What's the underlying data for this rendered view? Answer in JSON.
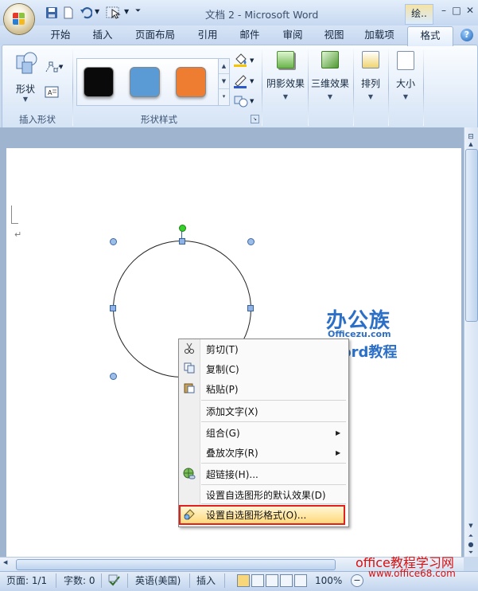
{
  "window": {
    "title": "文档 2 - Microsoft Word",
    "context_tool": "绘..",
    "controls": [
      "–",
      "□",
      "✕"
    ]
  },
  "tabs": [
    "开始",
    "插入",
    "页面布局",
    "引用",
    "邮件",
    "审阅",
    "视图",
    "加载项",
    "格式"
  ],
  "active_tab": "格式",
  "ribbon": {
    "groups": [
      {
        "label": "插入形状",
        "buttons": [
          "形状"
        ]
      },
      {
        "label": "形状样式",
        "swatches": [
          "#0a0a0a",
          "#5a9bd5",
          "#ee7d31"
        ]
      },
      {
        "label": "",
        "buttons": [
          "阴影效果"
        ]
      },
      {
        "label": "",
        "buttons": [
          "三维效果"
        ]
      },
      {
        "label": "",
        "buttons": [
          "排列"
        ]
      },
      {
        "label": "",
        "buttons": [
          "大小"
        ]
      }
    ]
  },
  "context_menu": {
    "items": [
      {
        "label": "剪切(T)",
        "icon": "scissors-icon"
      },
      {
        "label": "复制(C)",
        "icon": "copy-icon"
      },
      {
        "label": "粘贴(P)",
        "icon": "paste-icon"
      },
      {
        "label": "添加文字(X)",
        "icon": ""
      },
      {
        "label": "组合(G)",
        "icon": "",
        "submenu": true
      },
      {
        "label": "叠放次序(R)",
        "icon": "",
        "submenu": true
      },
      {
        "label": "超链接(H)...",
        "icon": "globe-link-icon"
      },
      {
        "label": "设置自选图形的默认效果(D)",
        "icon": ""
      },
      {
        "label": "设置自选图形格式(O)...",
        "icon": "format-shape-icon",
        "highlighted": true
      }
    ]
  },
  "watermark": {
    "logo": "办公族",
    "site": "Officezu.com",
    "subtitle": "Word教程",
    "footer_title": "office教程学习网",
    "footer_url": "www.office68.com"
  },
  "status_bar": {
    "page": "页面: 1/1",
    "words": "字数: 0",
    "language": "英语(美国)",
    "mode": "插入",
    "zoom": "100%"
  }
}
